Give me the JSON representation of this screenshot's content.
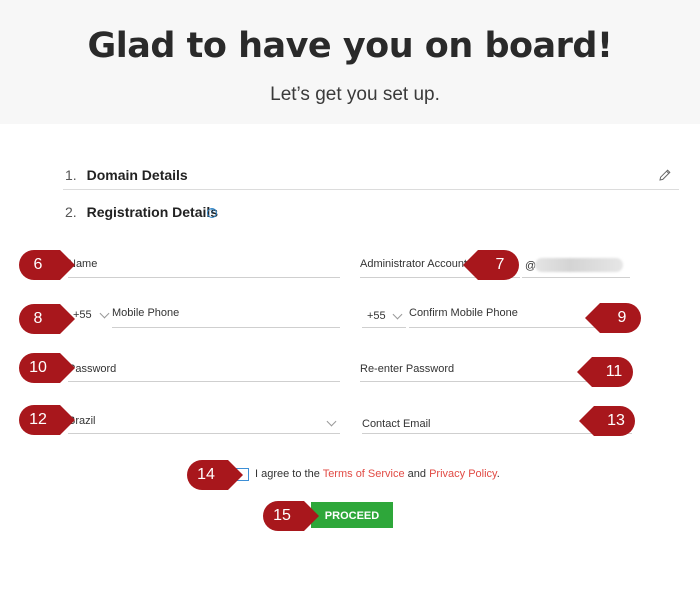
{
  "header": {
    "title": "Glad to have you on board!",
    "subtitle": "Let’s get you set up."
  },
  "steps": [
    {
      "number": "1.",
      "label": "Domain Details"
    },
    {
      "number": "2.",
      "label": "Registration Details"
    }
  ],
  "form": {
    "name_placeholder": "Name",
    "admin_account_placeholder": "Administrator Account",
    "admin_account_suffix": "@",
    "mobile_country_code": "+55",
    "mobile_placeholder": "Mobile Phone",
    "confirm_country_code": "+55",
    "confirm_mobile_placeholder": "Confirm Mobile Phone",
    "password_placeholder": "Password",
    "reenter_password_placeholder": "Re-enter Password",
    "country_value": "Brazil",
    "contact_email_placeholder": "Contact Email"
  },
  "agreement": {
    "prefix": "I agree to the",
    "terms_link": "Terms of Service",
    "and": "and",
    "privacy_link": "Privacy Policy",
    "suffix": "."
  },
  "proceed_label": "PROCEED",
  "markers": {
    "name": "6",
    "admin": "7",
    "mobile": "8",
    "confirm_mobile": "9",
    "password": "10",
    "reenter_password": "11",
    "country": "12",
    "contact_email": "13",
    "checkbox": "14",
    "proceed": "15"
  },
  "colors": {
    "marker_red": "#a8171c",
    "proceed_green": "#2ea73a",
    "link_red": "#e14b45",
    "help_blue": "#2d84c8"
  },
  "icons": [
    "pencil-icon",
    "help-icon",
    "chevron-down-icon"
  ]
}
